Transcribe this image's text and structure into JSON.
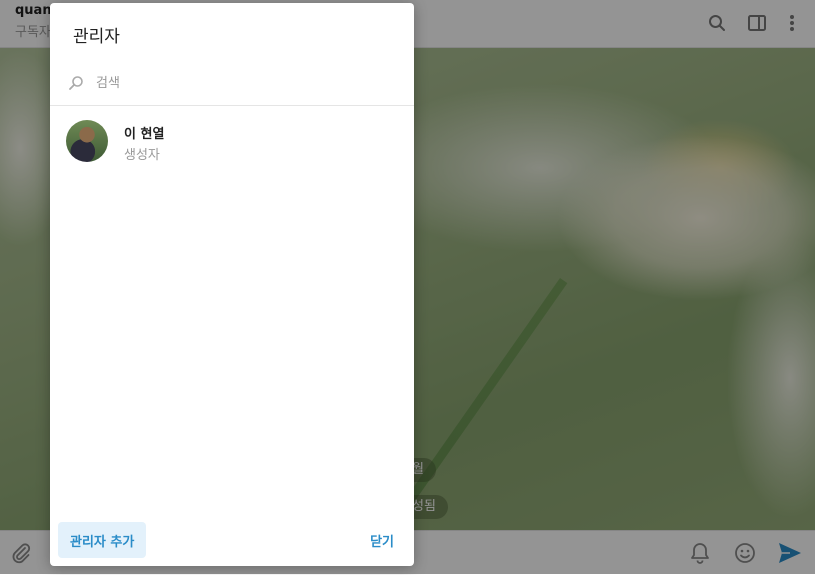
{
  "chat": {
    "title_partial": "quan",
    "subtitle_partial": "구독자",
    "date_pill_partial": "월",
    "service_pill_partial": "성됨"
  },
  "dialog": {
    "title": "관리자",
    "search_placeholder": "검색",
    "members": [
      {
        "name": "이 현열",
        "role": "생성자"
      }
    ],
    "add_admin_label": "관리자 추가",
    "close_label": "닫기"
  },
  "colors": {
    "accent": "#2a8cc8",
    "add_button_bg": "#e3f1fb",
    "overlay": "rgba(0,0,0,0.42)"
  },
  "icons": {
    "search": "search-icon",
    "sidebar": "sidebar-toggle-icon",
    "more": "more-vertical-icon",
    "attach": "paperclip-icon",
    "notify": "bell-icon",
    "emoji": "smile-icon",
    "send": "send-icon"
  }
}
